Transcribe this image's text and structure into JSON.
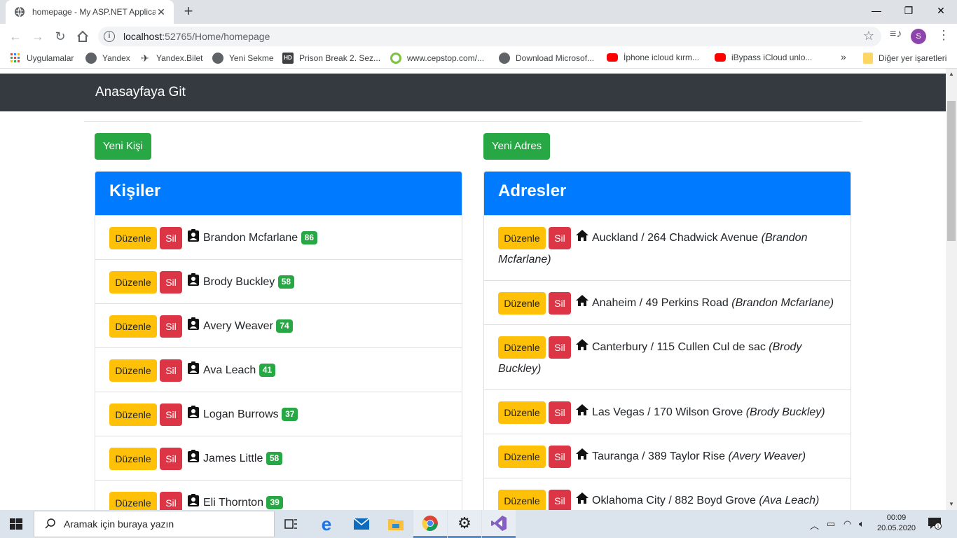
{
  "browser": {
    "tab_title": "homepage - My ASP.NET Applica",
    "tab_close": "✕",
    "new_tab": "+",
    "minimize": "—",
    "restore": "❐",
    "close": "✕",
    "url_host": "localhost",
    "url_path": ":52765/Home/homepage",
    "avatar_letter": "S"
  },
  "bookmarks": [
    {
      "label": "Uygulamalar",
      "icon": "apps-grid-icon"
    },
    {
      "label": "Yandex",
      "icon": "globe-icon"
    },
    {
      "label": "Yandex.Bilet",
      "icon": "plane-icon"
    },
    {
      "label": "Yeni Sekme",
      "icon": "globe-icon"
    },
    {
      "label": "Prison Break 2. Sez...",
      "icon": "hd-icon"
    },
    {
      "label": "www.cepstop.com/...",
      "icon": "cepstop-icon"
    },
    {
      "label": "Download Microsof...",
      "icon": "globe-icon"
    },
    {
      "label": "İphone icloud kırm...",
      "icon": "youtube-icon"
    },
    {
      "label": "iBypass iCloud unlo...",
      "icon": "youtube-icon"
    }
  ],
  "bookmarks_more": "»",
  "other_bookmarks": "Diğer yer işaretleri",
  "page": {
    "brand": "Anasayfaya Git",
    "new_person": "Yeni Kişi",
    "new_address": "Yeni Adres",
    "edit_label": "Düzenle",
    "delete_label": "Sil",
    "people_title": "Kişiler",
    "addresses_title": "Adresler"
  },
  "people": [
    {
      "name": "Brandon Mcfarlane",
      "age": "86"
    },
    {
      "name": "Brody Buckley",
      "age": "58"
    },
    {
      "name": "Avery Weaver",
      "age": "74"
    },
    {
      "name": "Ava Leach",
      "age": "41"
    },
    {
      "name": "Logan Burrows",
      "age": "37"
    },
    {
      "name": "James Little",
      "age": "58"
    },
    {
      "name": "Eli Thornton",
      "age": "39"
    }
  ],
  "addresses": [
    {
      "text": "Auckland / 264 Chadwick Avenue",
      "owner": "(Brandon Mcfarlane)"
    },
    {
      "text": "Anaheim / 49 Perkins Road",
      "owner": "(Brandon Mcfarlane)"
    },
    {
      "text": "Canterbury / 115 Cullen Cul de sac",
      "owner": "(Brody Buckley)"
    },
    {
      "text": "Las Vegas / 170 Wilson Grove",
      "owner": "(Brody Buckley)"
    },
    {
      "text": "Tauranga / 389 Taylor Rise",
      "owner": "(Avery Weaver)"
    },
    {
      "text": "Oklahoma City / 882 Boyd Grove",
      "owner": "(Ava Leach)"
    }
  ],
  "taskbar": {
    "search_placeholder": "Aramak için buraya yazın",
    "time": "00:09",
    "date": "20.05.2020",
    "notification_count": "1"
  },
  "colors": {
    "primary": "#007bff",
    "success": "#28a745",
    "warning": "#ffc107",
    "danger": "#dc3545",
    "navbar": "#343a40"
  }
}
